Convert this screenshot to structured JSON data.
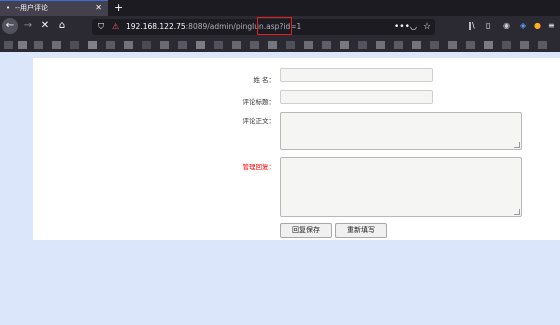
{
  "browser": {
    "tab": {
      "title": "--用户评论"
    },
    "url": {
      "host": "192.168.122.75",
      "rest": ":8089/admin/pinglun.asp?id=1"
    }
  },
  "form": {
    "name": {
      "label": "姓 名：",
      "value": ""
    },
    "title": {
      "label": "评论标题：",
      "value": ""
    },
    "body": {
      "label": "评论正文：",
      "value": ""
    },
    "reply": {
      "label": "管理回复：",
      "value": ""
    },
    "save_label": "回复保存",
    "reset_label": "重新填写"
  },
  "colors": {
    "page_bg": "#dce6fa",
    "reply_label": "#ff0000",
    "url_highlight_box": "#e02020"
  }
}
